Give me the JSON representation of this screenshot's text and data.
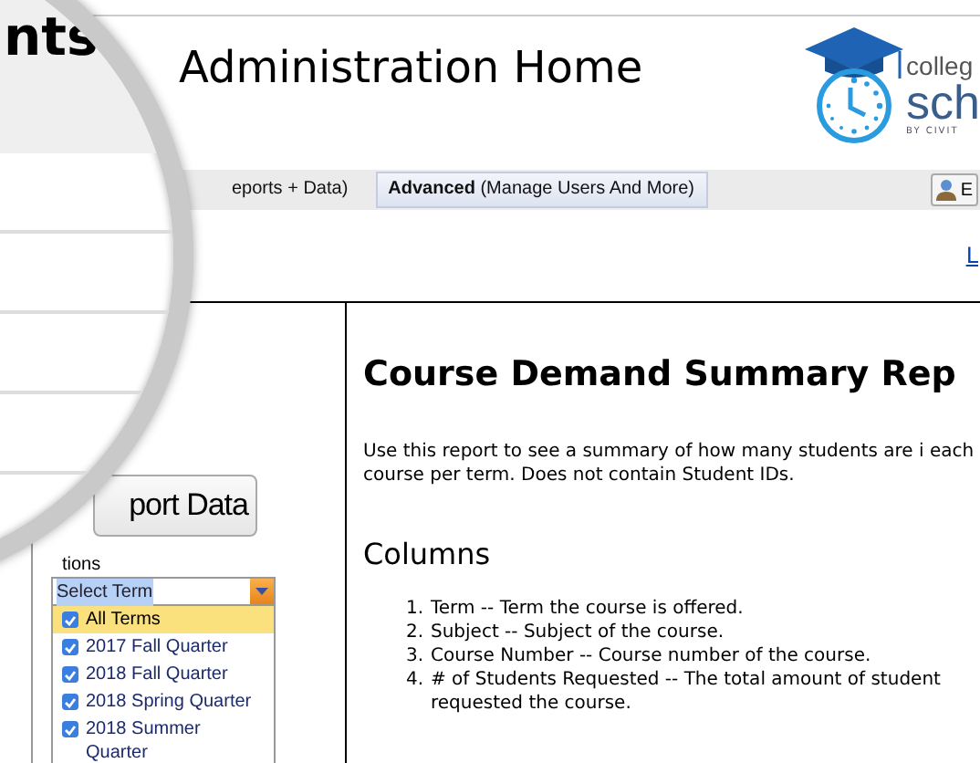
{
  "magnifier": {
    "text": "nts"
  },
  "header": {
    "title": "Administration Home",
    "logo": {
      "line1": "colleg",
      "line2": "sch",
      "tagline": "BY CIVIT"
    }
  },
  "nav": {
    "tabs": [
      {
        "label": "eports + Data)",
        "selected": false
      },
      {
        "label": "**Advanced** (Manage Users And More)",
        "selected": true
      }
    ],
    "user_button": "E"
  },
  "link": "L",
  "sidebar": {
    "button": "port Data",
    "options_label": "tions",
    "select": {
      "value": "Select Term"
    },
    "terms": [
      {
        "label": "All Terms",
        "checked": true,
        "selected": true
      },
      {
        "label": "2017 Fall Quarter",
        "checked": true,
        "selected": false
      },
      {
        "label": "2018 Fall Quarter",
        "checked": true,
        "selected": false
      },
      {
        "label": "2018 Spring Quarter",
        "checked": true,
        "selected": false
      },
      {
        "label": "2018 Summer Quarter",
        "checked": true,
        "selected": false
      }
    ]
  },
  "report": {
    "title": "Course Demand Summary Rep",
    "description": "Use this report to see a summary of how many students are i each course per term. Does not contain Student IDs.",
    "columns_heading": "Columns",
    "columns": [
      {
        "number": "1.",
        "text": "Term -- Term the course is offered."
      },
      {
        "number": "2.",
        "text": "Subject -- Subject of the course."
      },
      {
        "number": "3.",
        "text": "Course Number -- Course number of the course."
      },
      {
        "number": "4.",
        "text": "# of Students Requested -- The total amount of student requested the course."
      }
    ]
  }
}
